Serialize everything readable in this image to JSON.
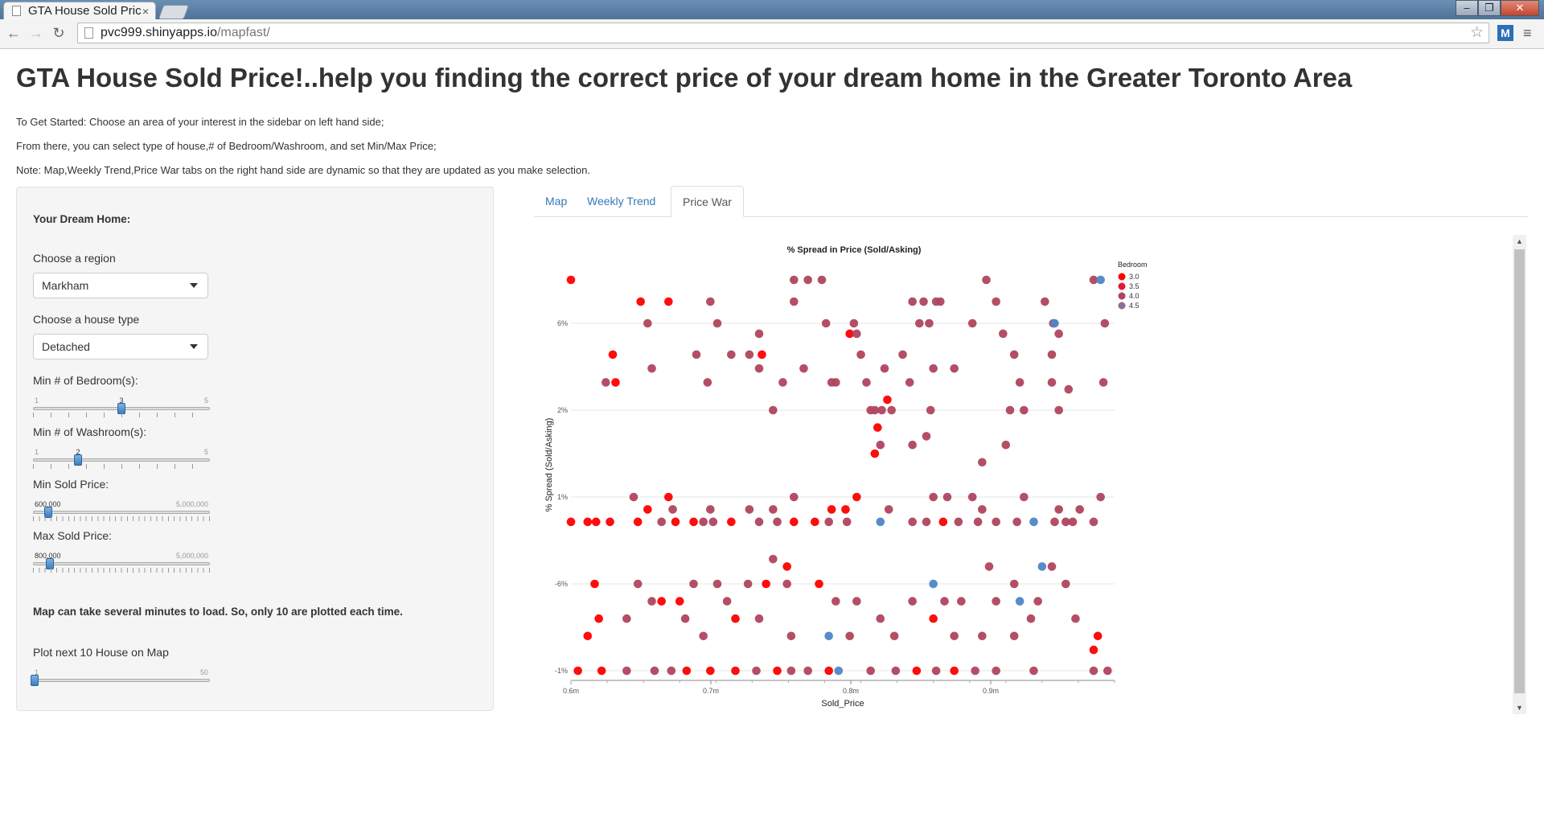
{
  "browser": {
    "tab_title": "GTA House Sold Pric",
    "tab_close": "×",
    "url_host": "pvc999.shinyapps.io",
    "url_path": "/mapfast/"
  },
  "page": {
    "title": "GTA House Sold Price!..help you finding the correct price of your dream home in the Greater Toronto Area",
    "intro_1": "To Get Started: Choose an area of your interest in the sidebar on left hand side;",
    "intro_2": "From there, you can select type of house,# of Bedroom/Washroom, and set Min/Max Price;",
    "intro_3": "Note: Map,Weekly Trend,Price War tabs on the right hand side are dynamic so that they are updated as you make selection."
  },
  "sidebar": {
    "heading": "Your Dream Home:",
    "region_label": "Choose a region",
    "region_value": "Markham",
    "house_type_label": "Choose a house type",
    "house_type_value": "Detached",
    "bedroom_label": "Min # of Bedroom(s):",
    "bedroom": {
      "min": "1",
      "max": "5",
      "value": "3",
      "fraction": 0.5
    },
    "washroom_label": "Min # of Washroom(s):",
    "washroom": {
      "min": "1",
      "max": "5",
      "value": "2",
      "fraction": 0.25
    },
    "min_price_label": "Min Sold Price:",
    "min_price": {
      "min": "",
      "max": "5,000,000",
      "value": "600,000",
      "fraction": 0.08
    },
    "max_price_label": "Max Sold Price:",
    "max_price": {
      "min": "",
      "max": "5,000,000",
      "value": "800,000",
      "fraction": 0.09
    },
    "map_note": "Map can take several minutes to load. So, only 10 are plotted each time.",
    "plot_next_label": "Plot next 10 House on Map",
    "plot_next": {
      "min": "1",
      "max": "50",
      "value": "",
      "fraction": 0.0
    }
  },
  "tabs": [
    {
      "label": "Map",
      "active": false
    },
    {
      "label": "Weekly Trend",
      "active": false
    },
    {
      "label": "Price War",
      "active": true
    }
  ],
  "chart_data": {
    "type": "scatter",
    "title": "% Spread in Price (Sold/Asking)",
    "xlabel": "Sold_Price",
    "ylabel": "% Spread (Sold/Asking)",
    "x_ticks": [
      {
        "value": 0.6,
        "label": "0.6m"
      },
      {
        "value": 0.7,
        "label": "0.7m"
      },
      {
        "value": 0.8,
        "label": "0.8m"
      },
      {
        "value": 0.9,
        "label": "0.9m"
      }
    ],
    "y_ticks": [
      "-1%",
      "-6%",
      "1%",
      "2%",
      "6%"
    ],
    "xlim": [
      0.6,
      0.9
    ],
    "y_scale": "categorical-ordered",
    "grid": true,
    "legend": {
      "title": "Bedroom",
      "placement": "top-right",
      "entries": [
        {
          "label": "3.0",
          "color": "#ff0000"
        },
        {
          "label": "3.5",
          "color": "#e4163c"
        },
        {
          "label": "4.0",
          "color": "#b0445e"
        },
        {
          "label": "4.5",
          "color": "#8a6f99"
        }
      ]
    },
    "colors": {
      "3.0": "#ff0000",
      "3.5": "#e4163c",
      "4.0": "#b0445e",
      "4.5": "#8a6f99",
      "5.0": "#4f86c6"
    },
    "points": [
      {
        "x": 0.6,
        "y": 7.3,
        "b": 3
      },
      {
        "x": 0.65,
        "y": 6.9,
        "b": 3
      },
      {
        "x": 0.67,
        "y": 6.9,
        "b": 3
      },
      {
        "x": 0.655,
        "y": 6.5,
        "b": 4
      },
      {
        "x": 0.63,
        "y": 5.6,
        "b": 3
      },
      {
        "x": 0.632,
        "y": 4.8,
        "b": 3
      },
      {
        "x": 0.625,
        "y": 4.8,
        "b": 4
      },
      {
        "x": 0.658,
        "y": 5.2,
        "b": 4
      },
      {
        "x": 0.69,
        "y": 5.6,
        "b": 4
      },
      {
        "x": 0.7,
        "y": 6.9,
        "b": 4
      },
      {
        "x": 0.705,
        "y": 6.5,
        "b": 4
      },
      {
        "x": 0.715,
        "y": 5.6,
        "b": 4
      },
      {
        "x": 0.728,
        "y": 5.6,
        "b": 4
      },
      {
        "x": 0.735,
        "y": 6.2,
        "b": 4
      },
      {
        "x": 0.737,
        "y": 5.6,
        "b": 3
      },
      {
        "x": 0.698,
        "y": 4.8,
        "b": 4
      },
      {
        "x": 0.735,
        "y": 5.2,
        "b": 4
      },
      {
        "x": 0.752,
        "y": 4.8,
        "b": 4
      },
      {
        "x": 0.745,
        "y": 4.0,
        "b": 4
      },
      {
        "x": 0.76,
        "y": 6.9,
        "b": 4
      },
      {
        "x": 0.77,
        "y": 7.3,
        "b": 4
      },
      {
        "x": 0.76,
        "y": 7.3,
        "b": 4
      },
      {
        "x": 0.78,
        "y": 7.3,
        "b": 4
      },
      {
        "x": 0.767,
        "y": 5.2,
        "b": 4
      },
      {
        "x": 0.783,
        "y": 6.5,
        "b": 4
      },
      {
        "x": 0.79,
        "y": 4.8,
        "b": 4
      },
      {
        "x": 0.787,
        "y": 4.8,
        "b": 4
      },
      {
        "x": 0.8,
        "y": 6.2,
        "b": 3
      },
      {
        "x": 0.805,
        "y": 6.2,
        "b": 4
      },
      {
        "x": 0.808,
        "y": 5.6,
        "b": 4
      },
      {
        "x": 0.803,
        "y": 6.5,
        "b": 4
      },
      {
        "x": 0.812,
        "y": 4.8,
        "b": 4
      },
      {
        "x": 0.815,
        "y": 4.0,
        "b": 4
      },
      {
        "x": 0.818,
        "y": 4.0,
        "b": 4
      },
      {
        "x": 0.82,
        "y": 3.6,
        "b": 3
      },
      {
        "x": 0.823,
        "y": 4.0,
        "b": 4
      },
      {
        "x": 0.827,
        "y": 4.3,
        "b": 3
      },
      {
        "x": 0.83,
        "y": 4.0,
        "b": 4
      },
      {
        "x": 0.825,
        "y": 5.2,
        "b": 4
      },
      {
        "x": 0.838,
        "y": 5.6,
        "b": 4
      },
      {
        "x": 0.843,
        "y": 4.8,
        "b": 4
      },
      {
        "x": 0.845,
        "y": 6.9,
        "b": 4
      },
      {
        "x": 0.85,
        "y": 6.5,
        "b": 4
      },
      {
        "x": 0.853,
        "y": 6.9,
        "b": 4
      },
      {
        "x": 0.857,
        "y": 6.5,
        "b": 4
      },
      {
        "x": 0.862,
        "y": 6.9,
        "b": 4
      },
      {
        "x": 0.865,
        "y": 6.9,
        "b": 4
      },
      {
        "x": 0.86,
        "y": 5.2,
        "b": 4
      },
      {
        "x": 0.858,
        "y": 4.0,
        "b": 4
      },
      {
        "x": 0.855,
        "y": 3.4,
        "b": 4
      },
      {
        "x": 0.822,
        "y": 3.2,
        "b": 4
      },
      {
        "x": 0.818,
        "y": 3.0,
        "b": 3
      },
      {
        "x": 0.845,
        "y": 3.2,
        "b": 4
      },
      {
        "x": 0.875,
        "y": 5.2,
        "b": 4
      },
      {
        "x": 0.888,
        "y": 6.5,
        "b": 4
      },
      {
        "x": 0.898,
        "y": 7.3,
        "b": 4
      },
      {
        "x": 0.905,
        "y": 6.9,
        "b": 4
      },
      {
        "x": 0.91,
        "y": 6.2,
        "b": 4
      },
      {
        "x": 0.918,
        "y": 5.6,
        "b": 4
      },
      {
        "x": 0.922,
        "y": 4.8,
        "b": 4
      },
      {
        "x": 0.915,
        "y": 4.0,
        "b": 4
      },
      {
        "x": 0.925,
        "y": 4.0,
        "b": 4
      },
      {
        "x": 0.912,
        "y": 3.2,
        "b": 4
      },
      {
        "x": 0.895,
        "y": 2.8,
        "b": 4
      },
      {
        "x": 0.94,
        "y": 6.9,
        "b": 4
      },
      {
        "x": 0.946,
        "y": 6.5,
        "b": 4
      },
      {
        "x": 0.95,
        "y": 6.2,
        "b": 4
      },
      {
        "x": 0.945,
        "y": 5.6,
        "b": 4
      },
      {
        "x": 0.945,
        "y": 4.8,
        "b": 4
      },
      {
        "x": 0.957,
        "y": 4.6,
        "b": 4
      },
      {
        "x": 0.95,
        "y": 4.0,
        "b": 4
      },
      {
        "x": 0.975,
        "y": 7.3,
        "b": 4
      },
      {
        "x": 0.98,
        "y": 7.3,
        "b": 5
      },
      {
        "x": 0.983,
        "y": 6.5,
        "b": 4
      },
      {
        "x": 0.982,
        "y": 4.8,
        "b": 4
      },
      {
        "x": 0.947,
        "y": 6.5,
        "b": 5
      },
      {
        "x": 0.98,
        "y": 2.0,
        "b": 4
      },
      {
        "x": 0.645,
        "y": 2.0,
        "b": 4
      },
      {
        "x": 0.67,
        "y": 2.0,
        "b": 3
      },
      {
        "x": 0.673,
        "y": 1.5,
        "b": 4
      },
      {
        "x": 0.7,
        "y": 1.5,
        "b": 4
      },
      {
        "x": 0.728,
        "y": 1.5,
        "b": 4
      },
      {
        "x": 0.745,
        "y": 1.5,
        "b": 4
      },
      {
        "x": 0.76,
        "y": 2.0,
        "b": 4
      },
      {
        "x": 0.787,
        "y": 1.5,
        "b": 3
      },
      {
        "x": 0.797,
        "y": 1.5,
        "b": 3
      },
      {
        "x": 0.805,
        "y": 2.0,
        "b": 3
      },
      {
        "x": 0.828,
        "y": 1.5,
        "b": 4
      },
      {
        "x": 0.86,
        "y": 2.0,
        "b": 4
      },
      {
        "x": 0.87,
        "y": 2.0,
        "b": 4
      },
      {
        "x": 0.888,
        "y": 2.0,
        "b": 4
      },
      {
        "x": 0.895,
        "y": 1.5,
        "b": 4
      },
      {
        "x": 0.925,
        "y": 2.0,
        "b": 4
      },
      {
        "x": 0.95,
        "y": 1.5,
        "b": 4
      },
      {
        "x": 0.965,
        "y": 1.5,
        "b": 4
      },
      {
        "x": 0.955,
        "y": 1.0,
        "b": 4
      },
      {
        "x": 0.6,
        "y": 1.0,
        "b": 3
      },
      {
        "x": 0.612,
        "y": 1.0,
        "b": 3
      },
      {
        "x": 0.618,
        "y": 1.0,
        "b": 3
      },
      {
        "x": 0.628,
        "y": 1.0,
        "b": 3
      },
      {
        "x": 0.648,
        "y": 1.0,
        "b": 3
      },
      {
        "x": 0.655,
        "y": 1.5,
        "b": 3
      },
      {
        "x": 0.665,
        "y": 1.0,
        "b": 4
      },
      {
        "x": 0.675,
        "y": 1.0,
        "b": 3
      },
      {
        "x": 0.688,
        "y": 1.0,
        "b": 3
      },
      {
        "x": 0.695,
        "y": 1.0,
        "b": 4
      },
      {
        "x": 0.702,
        "y": 1.0,
        "b": 4
      },
      {
        "x": 0.715,
        "y": 1.0,
        "b": 3
      },
      {
        "x": 0.735,
        "y": 1.0,
        "b": 4
      },
      {
        "x": 0.748,
        "y": 1.0,
        "b": 4
      },
      {
        "x": 0.76,
        "y": 1.0,
        "b": 3
      },
      {
        "x": 0.775,
        "y": 1.0,
        "b": 3
      },
      {
        "x": 0.785,
        "y": 1.0,
        "b": 4
      },
      {
        "x": 0.798,
        "y": 1.0,
        "b": 4
      },
      {
        "x": 0.822,
        "y": 1.0,
        "b": 5
      },
      {
        "x": 0.845,
        "y": 1.0,
        "b": 4
      },
      {
        "x": 0.855,
        "y": 1.0,
        "b": 4
      },
      {
        "x": 0.867,
        "y": 1.0,
        "b": 3
      },
      {
        "x": 0.878,
        "y": 1.0,
        "b": 4
      },
      {
        "x": 0.892,
        "y": 1.0,
        "b": 4
      },
      {
        "x": 0.905,
        "y": 1.0,
        "b": 4
      },
      {
        "x": 0.92,
        "y": 1.0,
        "b": 4
      },
      {
        "x": 0.932,
        "y": 1.0,
        "b": 5
      },
      {
        "x": 0.947,
        "y": 1.0,
        "b": 4
      },
      {
        "x": 0.96,
        "y": 1.0,
        "b": 4
      },
      {
        "x": 0.975,
        "y": 1.0,
        "b": 4
      },
      {
        "x": 0.745,
        "y": -0.5,
        "b": 4
      },
      {
        "x": 0.755,
        "y": -0.8,
        "b": 3
      },
      {
        "x": 0.938,
        "y": -0.8,
        "b": 5
      },
      {
        "x": 0.945,
        "y": -0.8,
        "b": 4
      },
      {
        "x": 0.9,
        "y": -0.8,
        "b": 4
      },
      {
        "x": 0.617,
        "y": -1.5,
        "b": 3
      },
      {
        "x": 0.648,
        "y": -1.5,
        "b": 4
      },
      {
        "x": 0.658,
        "y": -2.0,
        "b": 4
      },
      {
        "x": 0.665,
        "y": -2.0,
        "b": 3
      },
      {
        "x": 0.678,
        "y": -2.0,
        "b": 3
      },
      {
        "x": 0.688,
        "y": -1.5,
        "b": 4
      },
      {
        "x": 0.705,
        "y": -1.5,
        "b": 4
      },
      {
        "x": 0.712,
        "y": -2.0,
        "b": 4
      },
      {
        "x": 0.727,
        "y": -1.5,
        "b": 4
      },
      {
        "x": 0.74,
        "y": -1.5,
        "b": 3
      },
      {
        "x": 0.755,
        "y": -1.5,
        "b": 4
      },
      {
        "x": 0.778,
        "y": -1.5,
        "b": 3
      },
      {
        "x": 0.79,
        "y": -2.0,
        "b": 4
      },
      {
        "x": 0.805,
        "y": -2.0,
        "b": 4
      },
      {
        "x": 0.822,
        "y": -2.5,
        "b": 4
      },
      {
        "x": 0.845,
        "y": -2.0,
        "b": 4
      },
      {
        "x": 0.86,
        "y": -1.5,
        "b": 5
      },
      {
        "x": 0.868,
        "y": -2.0,
        "b": 4
      },
      {
        "x": 0.88,
        "y": -2.0,
        "b": 4
      },
      {
        "x": 0.905,
        "y": -2.0,
        "b": 4
      },
      {
        "x": 0.918,
        "y": -1.5,
        "b": 4
      },
      {
        "x": 0.922,
        "y": -2.0,
        "b": 5
      },
      {
        "x": 0.935,
        "y": -2.0,
        "b": 4
      },
      {
        "x": 0.955,
        "y": -1.5,
        "b": 4
      },
      {
        "x": 0.62,
        "y": -2.5,
        "b": 3
      },
      {
        "x": 0.612,
        "y": -3.0,
        "b": 3
      },
      {
        "x": 0.64,
        "y": -2.5,
        "b": 4
      },
      {
        "x": 0.682,
        "y": -2.5,
        "b": 4
      },
      {
        "x": 0.695,
        "y": -3.0,
        "b": 4
      },
      {
        "x": 0.718,
        "y": -2.5,
        "b": 3
      },
      {
        "x": 0.735,
        "y": -2.5,
        "b": 4
      },
      {
        "x": 0.758,
        "y": -3.0,
        "b": 4
      },
      {
        "x": 0.785,
        "y": -3.0,
        "b": 5
      },
      {
        "x": 0.8,
        "y": -3.0,
        "b": 4
      },
      {
        "x": 0.832,
        "y": -3.0,
        "b": 4
      },
      {
        "x": 0.86,
        "y": -2.5,
        "b": 3
      },
      {
        "x": 0.875,
        "y": -3.0,
        "b": 4
      },
      {
        "x": 0.895,
        "y": -3.0,
        "b": 4
      },
      {
        "x": 0.918,
        "y": -3.0,
        "b": 4
      },
      {
        "x": 0.93,
        "y": -2.5,
        "b": 4
      },
      {
        "x": 0.962,
        "y": -2.5,
        "b": 4
      },
      {
        "x": 0.978,
        "y": -3.0,
        "b": 3
      },
      {
        "x": 0.975,
        "y": -3.4,
        "b": 3
      },
      {
        "x": 0.605,
        "y": -4.0,
        "b": 3
      },
      {
        "x": 0.622,
        "y": -4.0,
        "b": 3
      },
      {
        "x": 0.64,
        "y": -4.0,
        "b": 4
      },
      {
        "x": 0.66,
        "y": -4.0,
        "b": 4
      },
      {
        "x": 0.672,
        "y": -4.0,
        "b": 4
      },
      {
        "x": 0.683,
        "y": -4.0,
        "b": 3
      },
      {
        "x": 0.7,
        "y": -4.0,
        "b": 3
      },
      {
        "x": 0.718,
        "y": -4.0,
        "b": 3
      },
      {
        "x": 0.733,
        "y": -4.0,
        "b": 4
      },
      {
        "x": 0.748,
        "y": -4.0,
        "b": 3
      },
      {
        "x": 0.758,
        "y": -4.0,
        "b": 4
      },
      {
        "x": 0.77,
        "y": -4.0,
        "b": 4
      },
      {
        "x": 0.785,
        "y": -4.0,
        "b": 3
      },
      {
        "x": 0.792,
        "y": -4.0,
        "b": 5
      },
      {
        "x": 0.815,
        "y": -4.0,
        "b": 4
      },
      {
        "x": 0.833,
        "y": -4.0,
        "b": 4
      },
      {
        "x": 0.848,
        "y": -4.0,
        "b": 3
      },
      {
        "x": 0.862,
        "y": -4.0,
        "b": 4
      },
      {
        "x": 0.875,
        "y": -4.0,
        "b": 3
      },
      {
        "x": 0.89,
        "y": -4.0,
        "b": 4
      },
      {
        "x": 0.905,
        "y": -4.0,
        "b": 4
      },
      {
        "x": 0.932,
        "y": -4.0,
        "b": 4
      },
      {
        "x": 0.975,
        "y": -4.0,
        "b": 4
      },
      {
        "x": 0.985,
        "y": -4.0,
        "b": 4
      }
    ]
  }
}
